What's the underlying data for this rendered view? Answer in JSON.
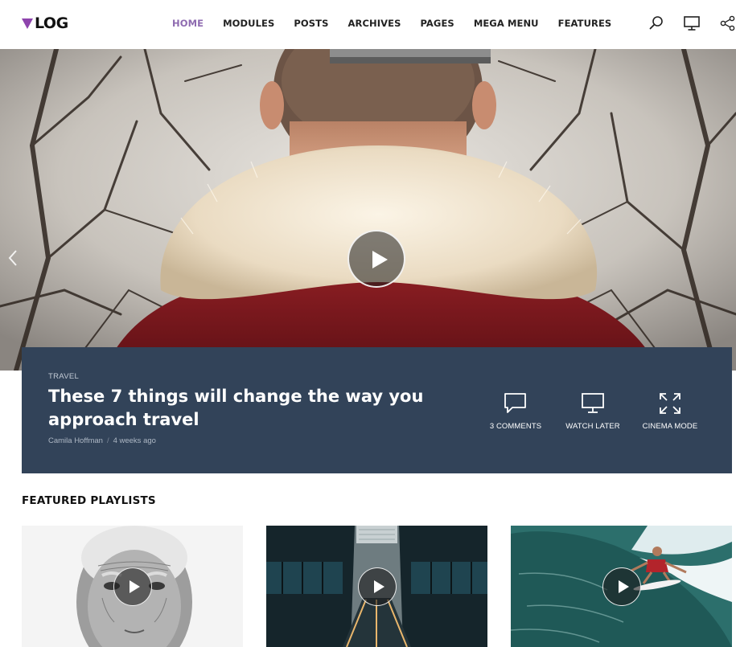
{
  "brand": {
    "logo_text": "LOG",
    "accent": "#8e44ad"
  },
  "nav": {
    "items": [
      {
        "label": "HOME",
        "active": true
      },
      {
        "label": "MODULES",
        "active": false
      },
      {
        "label": "POSTS",
        "active": false
      },
      {
        "label": "ARCHIVES",
        "active": false
      },
      {
        "label": "PAGES",
        "active": false
      },
      {
        "label": "MEGA MENU",
        "active": false
      },
      {
        "label": "FEATURES",
        "active": false
      }
    ],
    "active_color": "#8e6bb0"
  },
  "header_icons": [
    "search-icon",
    "monitor-icon",
    "share-icon"
  ],
  "hero": {
    "category": "TRAVEL",
    "title": "These 7 things will change the way you approach travel",
    "author": "Camila Hoffman",
    "meta_separator": "/",
    "date": "4 weeks ago",
    "panel_color": "#324359",
    "actions": [
      {
        "label": "3 COMMENTS",
        "icon": "comment-icon"
      },
      {
        "label": "WATCH LATER",
        "icon": "monitor-icon"
      },
      {
        "label": "CINEMA MODE",
        "icon": "expand-icon"
      }
    ]
  },
  "featured": {
    "title": "FEATURED PLAYLISTS",
    "cards": [
      {
        "subject": "old-man-portrait"
      },
      {
        "subject": "escalator-hall"
      },
      {
        "subject": "surfer-wave"
      }
    ]
  }
}
